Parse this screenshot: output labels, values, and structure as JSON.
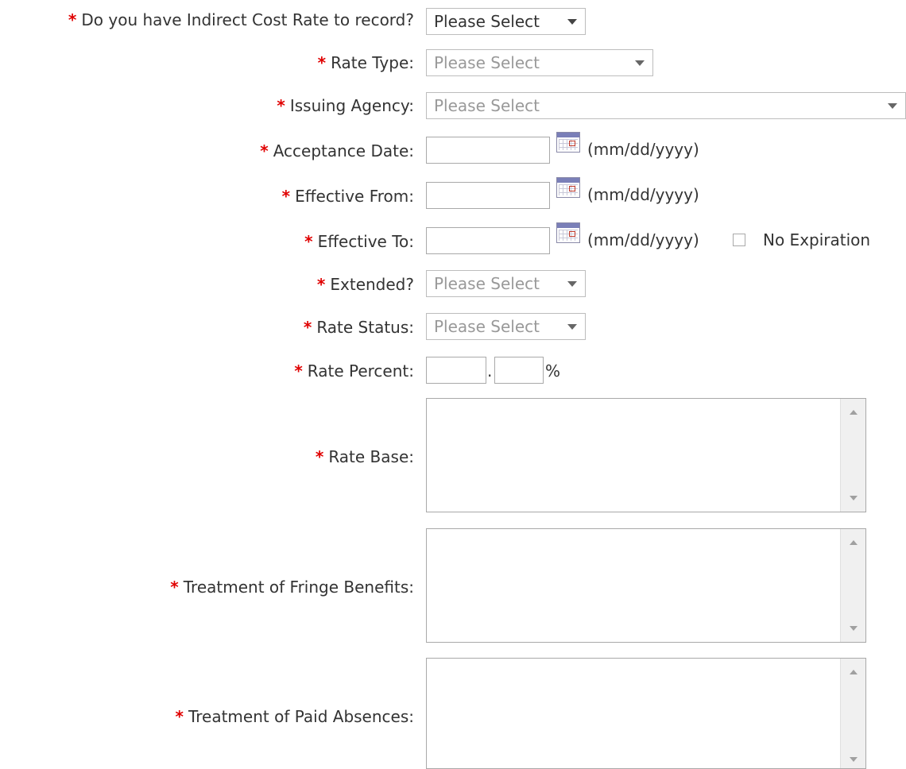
{
  "form": {
    "required_marker": "*",
    "placeholder": "Please Select",
    "date_hint": "(mm/dd/yyyy)",
    "fields": {
      "has_rate": {
        "label": "Do you have Indirect Cost Rate to record?",
        "value": "Please Select"
      },
      "rate_type": {
        "label": "Rate Type:",
        "value": "Please Select"
      },
      "issuing_agency": {
        "label": "Issuing Agency:",
        "value": "Please Select"
      },
      "acceptance_date": {
        "label": "Acceptance Date:",
        "value": ""
      },
      "effective_from": {
        "label": "Effective From:",
        "value": ""
      },
      "effective_to": {
        "label": "Effective To:",
        "value": "",
        "no_expiration_label": "No Expiration"
      },
      "extended": {
        "label": "Extended?",
        "value": "Please Select"
      },
      "rate_status": {
        "label": "Rate Status:",
        "value": "Please Select"
      },
      "rate_percent": {
        "label": "Rate Percent:",
        "separator": ".",
        "unit": "%"
      },
      "rate_base": {
        "label": "Rate Base:"
      },
      "fringe_benefits": {
        "label": "Treatment of Fringe Benefits:"
      },
      "paid_absences": {
        "label": "Treatment of Paid Absences:"
      }
    }
  },
  "colors": {
    "required": "#e00000",
    "text": "#333333",
    "disabled_text": "#999999"
  },
  "icons": {
    "calendar": "calendar-icon",
    "dropdown": "chevron-down-icon"
  }
}
